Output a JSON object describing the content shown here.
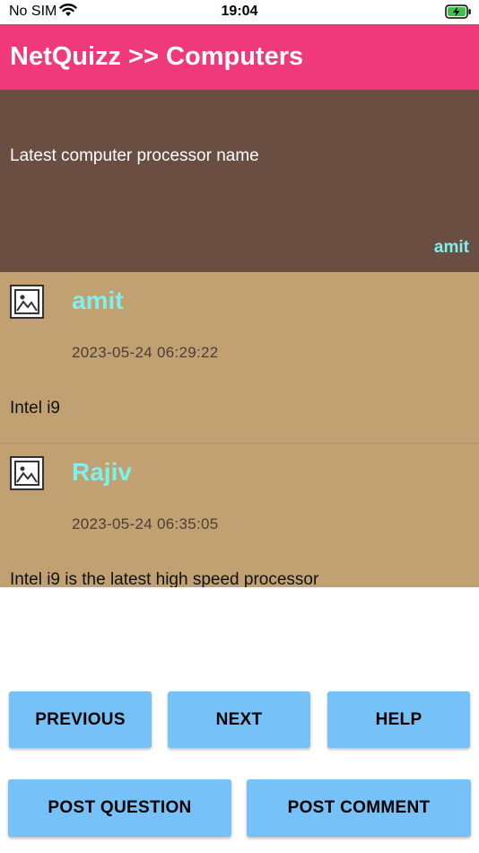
{
  "status_bar": {
    "carrier": "No SIM",
    "time": "19:04",
    "battery_icon": "battery-charging-icon",
    "wifi_icon": "wifi-icon"
  },
  "header": {
    "title": "NetQuizz >> Computers",
    "color": "#f0397a"
  },
  "question": {
    "text": "Latest computer processor name",
    "author": "amit",
    "background": "#6b4e42"
  },
  "comments": [
    {
      "author": "amit",
      "timestamp": "2023-05-24 06:29:22",
      "text": "Intel i9",
      "avatar_icon": "image-placeholder-icon"
    },
    {
      "author": "Rajiv",
      "timestamp": "2023-05-24 06:35:05",
      "text": "Intel i9 is the latest high speed processor",
      "avatar_icon": "image-placeholder-icon"
    }
  ],
  "buttons": {
    "previous": "PREVIOUS",
    "next": "NEXT",
    "help": "HELP",
    "post_question": "POST QUESTION",
    "post_comment": "POST COMMENT",
    "color": "#76c1f7"
  }
}
